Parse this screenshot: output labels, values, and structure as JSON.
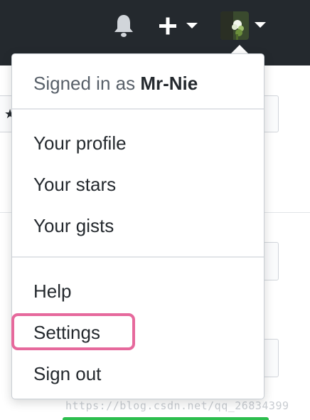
{
  "header": {
    "notifications_icon": "bell-icon",
    "create_icon": "plus-icon",
    "avatar_icon": "avatar-image"
  },
  "dropdown": {
    "signed_in_prefix": "Signed in as",
    "username": "Mr-Nie",
    "items_group1": [
      "Your profile",
      "Your stars",
      "Your gists"
    ],
    "items_group2": [
      "Help",
      "Settings",
      "Sign out"
    ],
    "highlighted_item": "Settings",
    "highlight_color": "#e6699c"
  },
  "watermark": "https://blog.csdn.net/qq_26834399",
  "colors": {
    "header_bg": "#24292e",
    "text_primary": "#24292e",
    "text_muted": "#586069"
  }
}
